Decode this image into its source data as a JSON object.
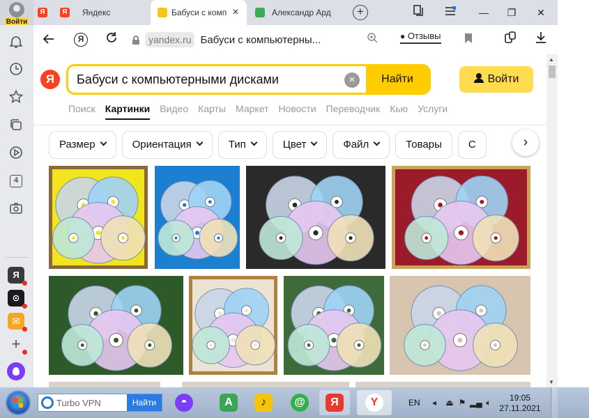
{
  "browser": {
    "profile_login": "Войти",
    "tabs": [
      {
        "label": "",
        "icon": "yandex-favicon"
      },
      {
        "label": "Яндекс",
        "icon": "yandex-favicon"
      },
      {
        "label": "Бабуси с комп",
        "icon": "images-favicon",
        "active": true
      },
      {
        "label": "Александр Ард",
        "icon": "green-favicon"
      }
    ],
    "tab_close": "×",
    "new_tab": "+",
    "window_controls": {
      "minimize": "—",
      "maximize": "❐",
      "close": "✕"
    },
    "address": {
      "domain": "yandex.ru",
      "page_title": "Бабуси с компьютерны...",
      "reviews_label": "Отзывы"
    }
  },
  "sidebar": {
    "items": [
      {
        "name": "notifications",
        "icon": "bell-icon"
      },
      {
        "name": "history",
        "icon": "clock-icon"
      },
      {
        "name": "bookmarks",
        "icon": "star-icon"
      },
      {
        "name": "collections",
        "icon": "cards-icon"
      },
      {
        "name": "video",
        "icon": "play-icon"
      },
      {
        "name": "counter",
        "icon": "four-icon",
        "label": "4"
      },
      {
        "name": "screenshot",
        "icon": "camera-icon"
      }
    ],
    "apps": [
      {
        "label": "Я",
        "color": "#3a3a3a"
      },
      {
        "label": "⊙",
        "color": "#1b1b1b"
      },
      {
        "label": "M",
        "color": "#f5a623"
      },
      {
        "label": "+",
        "color": "#6a6f78"
      }
    ],
    "alice_color": "#7b3cf5"
  },
  "search": {
    "logo": "Я",
    "query": "Бабуси с компьютерными дисками",
    "clear": "×",
    "find_button": "Найти",
    "login_button": "Войти"
  },
  "services": [
    "Поиск",
    "Картинки",
    "Видео",
    "Карты",
    "Маркет",
    "Новости",
    "Переводчик",
    "Кью",
    "Услуги"
  ],
  "active_service": "Картинки",
  "filters": [
    {
      "label": "Размер",
      "dropdown": true
    },
    {
      "label": "Ориентация",
      "dropdown": true
    },
    {
      "label": "Тип",
      "dropdown": true
    },
    {
      "label": "Цвет",
      "dropdown": true
    },
    {
      "label": "Файл",
      "dropdown": true
    },
    {
      "label": "Товары",
      "dropdown": false
    },
    {
      "label": "С",
      "dropdown": false
    }
  ],
  "results": [
    {
      "name": "cd-butterfly-yellow",
      "bg": "#f2e51e",
      "frame": "#8a6a3a"
    },
    {
      "name": "cd-owl-blue",
      "bg": "#1d7fd0",
      "frame": ""
    },
    {
      "name": "cd-wreath-dark",
      "bg": "#2a2a2a",
      "frame": ""
    },
    {
      "name": "cd-mosaic-red",
      "bg": "#9b1b2a",
      "frame": "#caa35a"
    },
    {
      "name": "cd-flower-green",
      "bg": "#2e5a2a",
      "frame": ""
    },
    {
      "name": "cd-owls-light",
      "bg": "#ece3d3",
      "frame": "#b08040"
    },
    {
      "name": "cd-dog-green",
      "bg": "#3f6b3a",
      "frame": ""
    },
    {
      "name": "cd-stack-beige",
      "bg": "#d8c5b0",
      "frame": ""
    }
  ],
  "taskbar": {
    "search_text": "Turbo VPN",
    "search_button": "Найти",
    "apps": [
      {
        "name": "alice",
        "color": "#7b3cf5",
        "glyph": "◓"
      },
      {
        "name": "market",
        "color": "#3aa655",
        "glyph": "A"
      },
      {
        "name": "music",
        "color": "#f6c40a",
        "glyph": "♪"
      },
      {
        "name": "icq",
        "color": "#34b04a",
        "glyph": "@"
      },
      {
        "name": "yandex",
        "color": "#e83a2c",
        "glyph": "Я"
      },
      {
        "name": "yandex-browser",
        "color": "#ffffff",
        "glyph": "Y"
      }
    ],
    "lang": "EN",
    "time": "19:05",
    "date": "27.11.2021"
  }
}
